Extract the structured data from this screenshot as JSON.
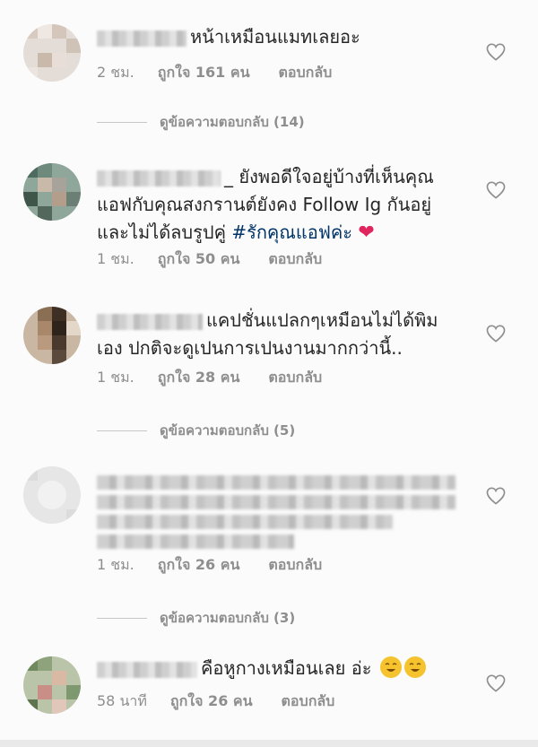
{
  "comments": [
    {
      "username_masked": "a          ",
      "text": "หน้าเหมือนแมทเลยอะ",
      "time": "2 ชม.",
      "likes": "ถูกใจ 161 คน",
      "reply": "ตอบกลับ"
    },
    {
      "username_visible": "_",
      "text_line1": "ยังพอดีใจอยู่บ้างที่เห็นคุณ",
      "text_line2": "แอฟกับคุณสงกรานต์ยังคง Follow Ig กันอยู่",
      "text_line3": "และไม่ได้ลบรูปคู่ ",
      "hashtag": "#รักคุณแอฟค่ะ",
      "emoji": "❤",
      "time": "1 ชม.",
      "likes": "ถูกใจ 50 คน",
      "reply": "ตอบกลับ"
    },
    {
      "text_line1": "แคปชั่นแปลกๆเหมือนไม่ได้พิม",
      "text_line2": "เอง ปกติจะดูเปนการเปนงานมากกว่านี้..",
      "time": "1 ชม.",
      "likes": "ถูกใจ 28 คน",
      "reply": "ตอบกลับ"
    },
    {
      "time": "1 ชม.",
      "likes": "ถูกใจ 26 คน",
      "reply": "ตอบกลับ"
    },
    {
      "text": "คือหูกางเหมือนเลย อ่ะ",
      "time": "58 นาที",
      "likes": "ถูกใจ 26 คน",
      "reply": "ตอบกลับ"
    }
  ],
  "view_replies": [
    "ดูข้อความตอบกลับ (14)",
    "ดูข้อความตอบกลับ (5)",
    "ดูข้อความตอบกลับ (3)"
  ],
  "colors": {
    "text": "#262626",
    "meta": "#8e8e8e",
    "hashtag": "#003569",
    "heart": "#e0245e"
  },
  "icons": [
    "heart-outline-icon",
    "red-heart-emoji",
    "laughing-face-emoji"
  ]
}
